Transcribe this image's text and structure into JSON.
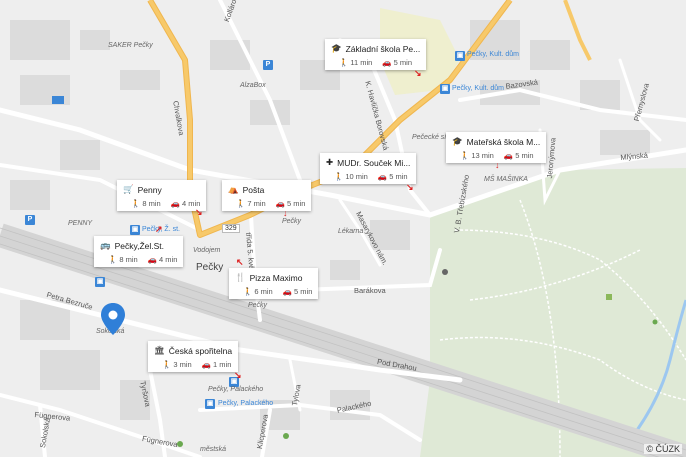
{
  "place_labels": {
    "saker": "SAKER Pečky",
    "alzabox": "AlzaBox",
    "kult1": "Pečky, Kult. dům",
    "kult2": "Pečky, Kult. dům",
    "pececka": "Pečecké sídl.",
    "ms_masinka": "MŠ MAŠINKA",
    "penny_map": "PENNY",
    "pecky_st": "Pečky, Ž. st.",
    "vodojem": "Vodojem",
    "pecky_town": "Pečky",
    "pecky_small": "Pečky",
    "pecky_small2": "Pečky",
    "lekarna": "Lékarna",
    "sokolska": "Sokolská",
    "pecky_palackeho_gray": "Pečky, Palackého",
    "pecky_palackeho_blue": "Pečky, Palackého",
    "mestska": "městská",
    "route329": "329"
  },
  "streets": {
    "kollarova": "Kollárova",
    "chvalkova": "Chvalkova",
    "kbodova": "K. Havlíčka Borovská",
    "bazovska": "Bazovská",
    "premyslova": "Přemyslova",
    "mlynska": "Mlýnská",
    "jeronymova": "Jeronýmova",
    "tledeckeho": "V. B. Třebízského",
    "masarykovo": "Masarykovo nám.",
    "petra_bezruce": "Petra Bezruče",
    "tyrsova": "Tyršova",
    "tylova": "Tylova",
    "barakova": "Barákova",
    "pod_drahou": "Pod Drahou",
    "fugnerova1": "Fügnerova",
    "fugnerova2": "Fügnerova",
    "palackeho": "Palackého",
    "klicperova": "Klicperova",
    "sokolska_st": "Sokolská",
    "hlavni_5_kv": "třída 5. květ"
  },
  "pois": [
    {
      "key": "zakladni",
      "icon": "graduation-cap-icon",
      "name": "Základní škola Pe...",
      "walk": "11 min",
      "car": "5 min"
    },
    {
      "key": "materska",
      "icon": "graduation-cap-icon",
      "name": "Mateřská škola M...",
      "walk": "13 min",
      "car": "5 min"
    },
    {
      "key": "mudr",
      "icon": "medical-cross-icon",
      "name": "MUDr. Souček Mi...",
      "walk": "10 min",
      "car": "5 min"
    },
    {
      "key": "penny",
      "icon": "shopping-cart-icon",
      "name": "Penny",
      "walk": "8 min",
      "car": "4 min"
    },
    {
      "key": "posta",
      "icon": "post-office-icon",
      "name": "Pošta",
      "walk": "7 min",
      "car": "5 min"
    },
    {
      "key": "pecky_zel",
      "icon": "train-icon",
      "name": "Pečky,Žel.St.",
      "walk": "8 min",
      "car": "4 min"
    },
    {
      "key": "pizza",
      "icon": "fork-knife-icon",
      "name": "Pizza Maximo",
      "walk": "6 min",
      "car": "5 min"
    },
    {
      "key": "ceska",
      "icon": "bank-icon",
      "name": "Česká spořitelna",
      "walk": "3 min",
      "car": "1 min"
    }
  ],
  "copyright": "© ČÚZK",
  "colors": {
    "main_road": "#f7c96a",
    "road": "#ffffff",
    "park": "#dfe9d6",
    "park_path": "#ffffff",
    "water": "#9cc7f0",
    "school_area": "#efefcf",
    "building": "#dcdcdc",
    "pin": "#2f7fd8",
    "arrow": "#d22222"
  }
}
